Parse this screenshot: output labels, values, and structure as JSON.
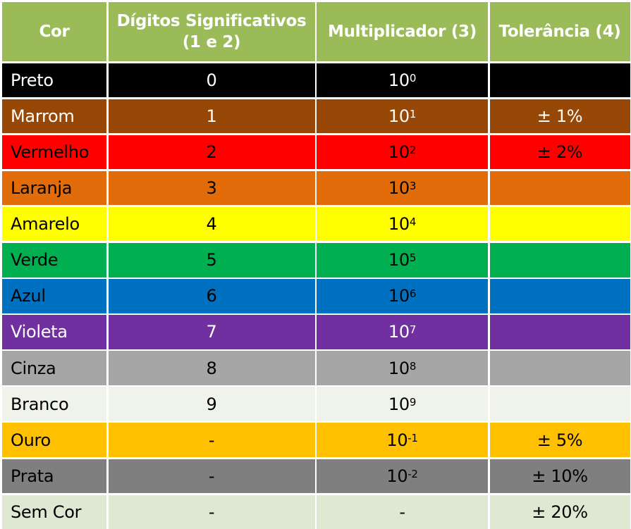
{
  "header": {
    "col_color": "Cor",
    "col_digits_line1": "Dígitos Significativos",
    "col_digits_line2": "(1 e 2)",
    "col_multiplier": "Multiplicador (3)",
    "col_tolerance": "Tolerância (4)",
    "background": "#9bbb59"
  },
  "rows": [
    {
      "name": "Preto",
      "digit": "0",
      "mult_base": "10",
      "mult_exp": "0",
      "tolerance": "",
      "bg": "#000000",
      "fg": "#ffffff"
    },
    {
      "name": "Marrom",
      "digit": "1",
      "mult_base": "10",
      "mult_exp": "1",
      "tolerance": "± 1%",
      "bg": "#974806",
      "fg": "#ffffff"
    },
    {
      "name": "Vermelho",
      "digit": "2",
      "mult_base": "10",
      "mult_exp": "2",
      "tolerance": "± 2%",
      "bg": "#ff0000",
      "fg": "#000000"
    },
    {
      "name": "Laranja",
      "digit": "3",
      "mult_base": "10",
      "mult_exp": "3",
      "tolerance": "",
      "bg": "#e36c0a",
      "fg": "#000000"
    },
    {
      "name": "Amarelo",
      "digit": "4",
      "mult_base": "10",
      "mult_exp": "4",
      "tolerance": "",
      "bg": "#ffff00",
      "fg": "#000000"
    },
    {
      "name": "Verde",
      "digit": "5",
      "mult_base": "10",
      "mult_exp": "5",
      "tolerance": "",
      "bg": "#00b050",
      "fg": "#000000"
    },
    {
      "name": "Azul",
      "digit": "6",
      "mult_base": "10",
      "mult_exp": "6",
      "tolerance": "",
      "bg": "#0070c0",
      "fg": "#000000"
    },
    {
      "name": "Violeta",
      "digit": "7",
      "mult_base": "10",
      "mult_exp": "7",
      "tolerance": "",
      "bg": "#7030a0",
      "fg": "#ffffff"
    },
    {
      "name": "Cinza",
      "digit": "8",
      "mult_base": "10",
      "mult_exp": "8",
      "tolerance": "",
      "bg": "#a6a6a6",
      "fg": "#000000"
    },
    {
      "name": "Branco",
      "digit": "9",
      "mult_base": "10",
      "mult_exp": "9",
      "tolerance": "",
      "bg": "#eff3ea",
      "fg": "#000000"
    },
    {
      "name": "Ouro",
      "digit": "-",
      "mult_base": "10",
      "mult_exp": "-1",
      "tolerance": "± 5%",
      "bg": "#ffc000",
      "fg": "#000000"
    },
    {
      "name": "Prata",
      "digit": "-",
      "mult_base": "10",
      "mult_exp": "-2",
      "tolerance": "± 10%",
      "bg": "#7f7f7f",
      "fg": "#000000"
    },
    {
      "name": "Sem Cor",
      "digit": "-",
      "mult_base": "-",
      "mult_exp": "",
      "tolerance": "± 20%",
      "bg": "#dfe8d3",
      "fg": "#000000"
    }
  ]
}
